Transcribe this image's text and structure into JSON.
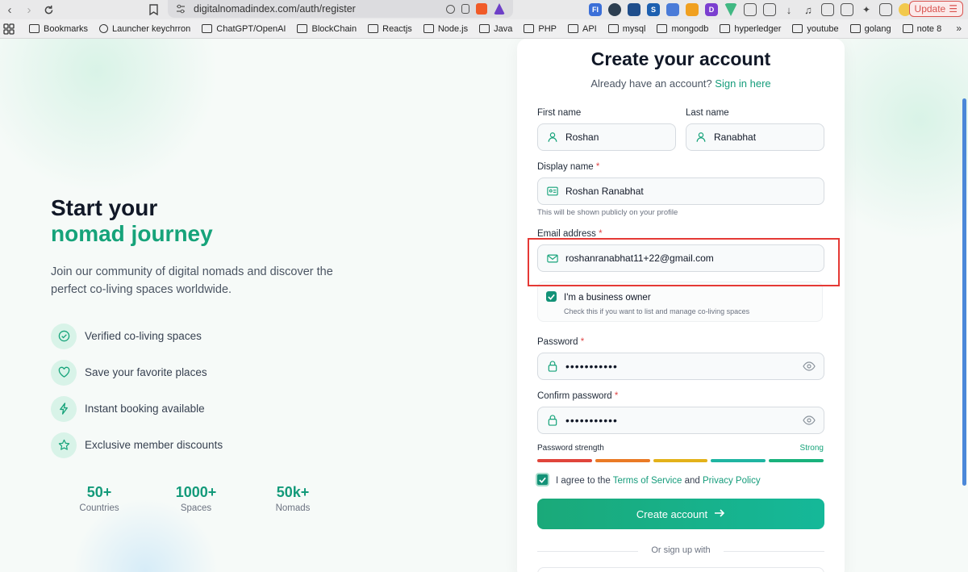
{
  "browser": {
    "url": "digitalnomadindex.com/auth/register",
    "update_label": "Update",
    "bookmarks": [
      "Bookmarks",
      "Launcher keychrron",
      "ChatGPT/OpenAI",
      "BlockChain",
      "Reactjs",
      "Node.js",
      "Java",
      "PHP",
      "API",
      "mysql",
      "mongodb",
      "hyperledger",
      "youtube",
      "golang",
      "note 8"
    ]
  },
  "hero": {
    "title_line1": "Start your",
    "title_line2": "nomad journey",
    "lead": "Join our community of digital nomads and discover the perfect co-living spaces worldwide.",
    "features": [
      {
        "icon": "check-circle-icon",
        "label": "Verified co-living spaces"
      },
      {
        "icon": "heart-icon",
        "label": "Save your favorite places"
      },
      {
        "icon": "bolt-icon",
        "label": "Instant booking available"
      },
      {
        "icon": "star-icon",
        "label": "Exclusive member discounts"
      }
    ],
    "stats": [
      {
        "value": "50+",
        "label": "Countries"
      },
      {
        "value": "1000+",
        "label": "Spaces"
      },
      {
        "value": "50k+",
        "label": "Nomads"
      }
    ]
  },
  "form": {
    "title": "Create your account",
    "subtitle_prefix": "Already have an account?",
    "signin_link": "Sign in here",
    "first_name": {
      "label": "First name",
      "value": "Roshan"
    },
    "last_name": {
      "label": "Last name",
      "value": "Ranabhat"
    },
    "display_name": {
      "label": "Display name",
      "required": "*",
      "value": "Roshan Ranabhat",
      "hint": "This will be shown publicly on your profile"
    },
    "email": {
      "label": "Email address",
      "required": "*",
      "value": "roshanranabhat11+22@gmail.com"
    },
    "business": {
      "title": "I'm a business owner",
      "desc": "Check this if you want to list and manage co-living spaces",
      "checked": true
    },
    "password": {
      "label": "Password",
      "required": "*",
      "value": "•••••••••••"
    },
    "confirm_password": {
      "label": "Confirm password",
      "required": "*",
      "value": "•••••••••••"
    },
    "strength": {
      "label": "Password strength",
      "value": "Strong",
      "bar_colors": [
        "#e0453b",
        "#ea7a26",
        "#e3b21a",
        "#1fb5a2",
        "#19b27c"
      ]
    },
    "agree": {
      "prefix": "I agree to the",
      "terms": "Terms of Service",
      "and": "and",
      "privacy": "Privacy Policy",
      "checked": true
    },
    "submit_label": "Create account",
    "divider_text": "Or sign up with"
  },
  "colors": {
    "accent": "#16a37a",
    "highlight_box": "#e53935"
  }
}
